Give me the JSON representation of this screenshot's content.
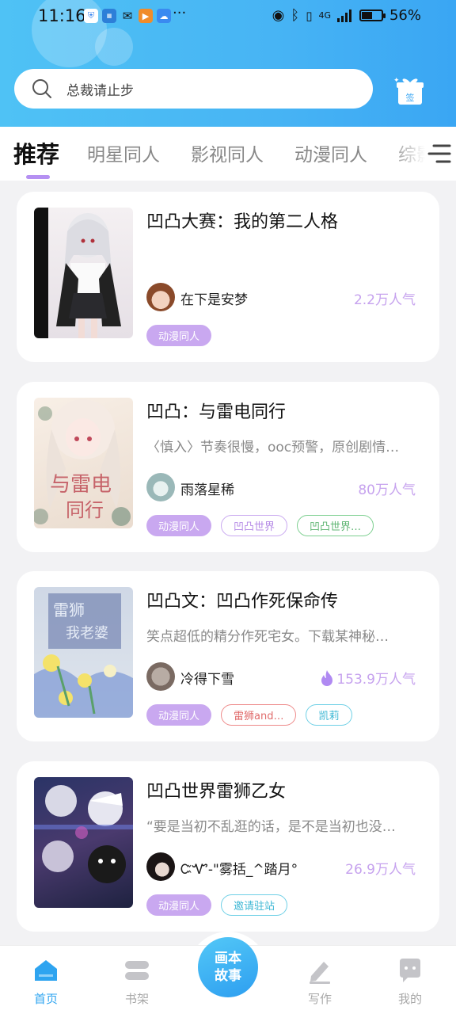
{
  "status_bar": {
    "time": "11:16",
    "more": "···",
    "network": "4G",
    "battery": "56%",
    "battery_level": 0.56
  },
  "search": {
    "placeholder": "总裁请止步",
    "checkin_label": "签"
  },
  "tabs": [
    {
      "label": "推荐",
      "active": true
    },
    {
      "label": "明星同人",
      "active": false
    },
    {
      "label": "影视同人",
      "active": false
    },
    {
      "label": "动漫同人",
      "active": false
    },
    {
      "label": "综影",
      "active": false
    }
  ],
  "cards": [
    {
      "title": "凹凸大赛：我的第二人格",
      "description": "",
      "author": "在下是安梦",
      "popularity": "2.2万人气",
      "hot": false,
      "tags": [
        {
          "label": "动漫同人",
          "style": "filled"
        }
      ]
    },
    {
      "title": "凹凸：与雷电同行",
      "description": "〈慎入〉节奏很慢，ooc预警，原创剧情…",
      "author": "雨落星稀",
      "popularity": "80万人气",
      "hot": false,
      "tags": [
        {
          "label": "动漫同人",
          "style": "filled"
        },
        {
          "label": "凹凸世界",
          "style": "out-purple"
        },
        {
          "label": "凹凸世界…",
          "style": "out-green"
        }
      ]
    },
    {
      "title": "凹凸文：凹凸作死保命传",
      "description": "笑点超低的精分作死宅女。下载某神秘…",
      "author": "冷得下雪",
      "popularity": "153.9万人气",
      "hot": true,
      "tags": [
        {
          "label": "动漫同人",
          "style": "filled"
        },
        {
          "label": "雷狮and…",
          "style": "out-red"
        },
        {
          "label": "凯莉",
          "style": "out-cyan"
        }
      ]
    },
    {
      "title": "凹凸世界雷狮乙女",
      "description": "“要是当初不乱逛的话，是不是当初也没…",
      "author": "ᏨᏉ-\"雾括_^踏月°",
      "popularity": "26.9万人气",
      "hot": false,
      "tags": [
        {
          "label": "动漫同人",
          "style": "filled"
        },
        {
          "label": "邀请驻站",
          "style": "out-cyan"
        }
      ]
    }
  ],
  "bottom_nav": {
    "home": "首页",
    "shelf": "书架",
    "center_line1": "画本",
    "center_line2": "故事",
    "write": "写作",
    "mine": "我的"
  },
  "colors": {
    "accent": "#2ea4f0",
    "tag_purple": "#c9a8f0",
    "header_blue": "#47b4f4"
  }
}
